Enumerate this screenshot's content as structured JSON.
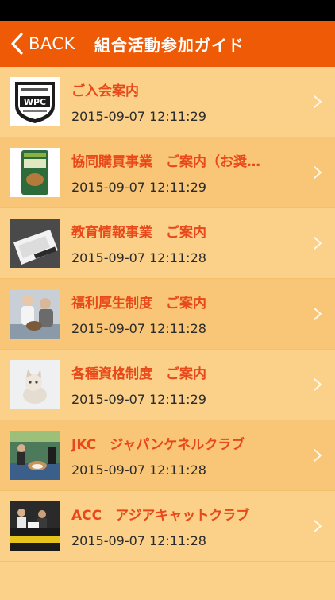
{
  "nav": {
    "back_label": "BACK",
    "title": "組合活動参加ガイド"
  },
  "items": [
    {
      "title": "ご入会案内",
      "date": "2015-09-07 12:11:29",
      "thumb": "wpc-logo"
    },
    {
      "title": "協同購買事業　ご案内（お奨…",
      "date": "2015-09-07 12:11:29",
      "thumb": "dog-food-bag"
    },
    {
      "title": "教育情報事業　ご案内",
      "date": "2015-09-07 12:11:28",
      "thumb": "documents-photo"
    },
    {
      "title": "福利厚生制度　ご案内",
      "date": "2015-09-07 12:11:28",
      "thumb": "vet-photo"
    },
    {
      "title": "各種資格制度　ご案内",
      "date": "2015-09-07 12:11:29",
      "thumb": "kitten-photo"
    },
    {
      "title": "JKC　ジャパンケネルクラブ",
      "date": "2015-09-07 12:11:28",
      "thumb": "dog-show-photo"
    },
    {
      "title": "ACC　アジアキャットクラブ",
      "date": "2015-09-07 12:11:28",
      "thumb": "cat-show-photo"
    }
  ],
  "thumb_labels": {
    "wpc": "WPC"
  }
}
